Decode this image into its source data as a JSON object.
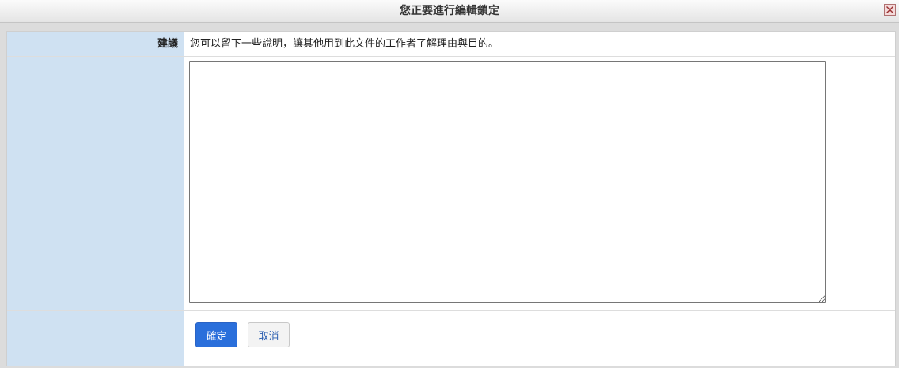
{
  "dialog": {
    "title": "您正要進行編輯鎖定",
    "close_icon": "close-icon"
  },
  "form": {
    "suggestion_label": "建議",
    "suggestion_text": "您可以留下一些說明，讓其他用到此文件的工作者了解理由與目的。",
    "reason_value": "",
    "confirm_label": "確定",
    "cancel_label": "取消"
  },
  "colors": {
    "label_bg": "#cfe1f2",
    "primary_button": "#2a6fdb",
    "cancel_text": "#2a5db0"
  }
}
